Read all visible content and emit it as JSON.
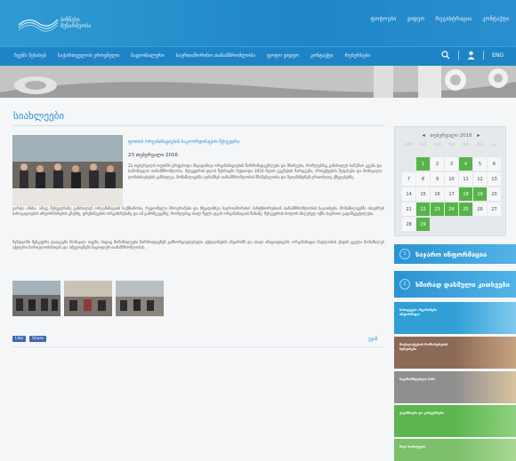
{
  "header": {
    "logo_text": "ბიზნესი\nმეწარმეობა",
    "top_links": [
      "ფოტოები",
      "ვიდეო",
      "რეგისტრაცია",
      "კონტაქტი"
    ]
  },
  "nav": {
    "items": [
      "ჩვენს შესახებ",
      "საქართველოს ეროვნული",
      "ნაციონალური",
      "საერთაშორისო თანამშრომლობა",
      "ფოტო ვიდეო",
      "კონტაქტი",
      "რესურსები"
    ],
    "lang": "ENG"
  },
  "page_title": "სიახლეები",
  "article": {
    "headline": "ფოთის ორგანიზაციების საკოორდინაციო შეხვედრა",
    "date": "23 თებერვალი 2016",
    "p1": "23 თებერვალს ოფისში ემატებოდა სხვადასხვა ორგანიზაციების წარმომადგენლები და მხარეები, რომლებმაც განიხილეს სამუშაო გეგმა და სამომავლო თანამშრომლობა. შეხვედრის დღის წესრიგში შედიოდა 2016 წლის გეგმების წარდგენა, პროექტების შეფასება და მომავალი ღონისძიებების განხილვა. მონაწილეებმა აღნიშნეს თანამშრომლობის მნიშვნელობა და შეთანხმდნენ ერთობლივ ქმედებებზე.",
    "p2": "გარდა ამისა, ამავე შეხვედრაზე განიხილეს ორგანიზაციის საქმიანობა, რეგიონული პროგრამები და სხვადასხვა საერთაშორისო პარტნიორებთან თანამშრომლობის საკითხები. მონაწილეებმა ისაუბრეს საზოგადოების ინფორმირების გზებზე, ტრენინგების ორგანიზებაზე და იმ გამოწვევებზე, რომლებიც ახალ წელს დგას ორგანიზაციის წინაშე. შეხვედრის ბოლოს მიღებულ იქნა საერთო გადაწყვეტილება.",
    "p3": "შემდგომი შეხვედრა დაიგეგმა მომავალ თვეში, სადაც მონაწილეები წარმოადგენენ განხორციელებული აქტივობების ანგარიშს და ახალ ინიციატივებს. ორგანიზაცია მადლობას უხდის ყველა მონაწილეს აქტიური ჩართულობისთვის და იმედოვნებს ნაყოფიერ თანამშრომლობას.",
    "share_like": "Like",
    "share_share": "Share",
    "back_link": "უკან"
  },
  "calendar": {
    "month": "თებერვალი 2016",
    "dow": [
      "ორშ",
      "სამ",
      "ოთხ",
      "ხუთ",
      "პარ",
      "შაბ",
      "კვი"
    ],
    "days": [
      "",
      "1",
      "2",
      "3",
      "4",
      "5",
      "6",
      "7",
      "8",
      "9",
      "10",
      "11",
      "12",
      "13",
      "14",
      "15",
      "16",
      "17",
      "18",
      "19",
      "20",
      "21",
      "22",
      "23",
      "24",
      "25",
      "26",
      "27",
      "28",
      "29"
    ],
    "event_days": [
      "1",
      "4",
      "18",
      "19",
      "22",
      "23",
      "24",
      "25",
      "29"
    ]
  },
  "sidebar": {
    "btn1_num": "1",
    "btn1_label": "საჯარო ინფორმაცია",
    "btn2_num": "2",
    "btn2_label": "ხშირად დასმული კითხვები",
    "promos": [
      {
        "text": "საბიუჯეტო ანგარიშები ინფორმაცია",
        "bg": "#2f9fd6"
      },
      {
        "text": "მოქალაქეების მომსახურების სერვისები",
        "bg": "#8d6a56"
      },
      {
        "text": "საკანონმდებლო ბაზა",
        "bg": "#8f8f8f"
      },
      {
        "text": "ვაკანსიები და კონკურსები",
        "bg": "#5cb64f"
      },
      {
        "text": "სხვა სიახლეები",
        "bg": "#7dbf6a"
      }
    ]
  }
}
